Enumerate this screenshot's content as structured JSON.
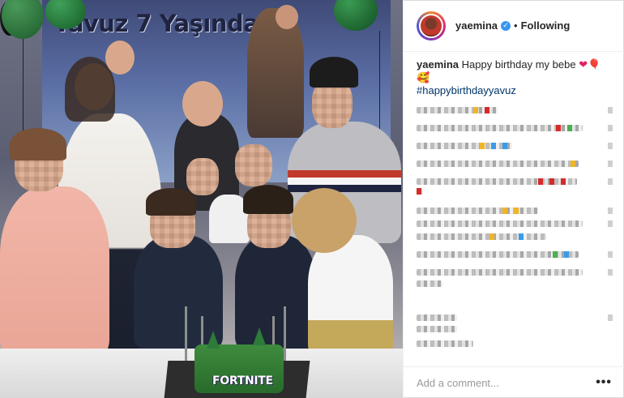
{
  "photo": {
    "banner_text": "Yavuz 7 Yaşında",
    "cake_text": "FORTNITE"
  },
  "header": {
    "username": "yaemina",
    "verified_icon": "verified-badge-icon",
    "separator": "•",
    "follow_status": "Following"
  },
  "caption": {
    "username": "yaemina",
    "text": "Happy birthday my bebe",
    "emoji": "❤🎈🥰",
    "hashtag": "#happybirthdayyavuz"
  },
  "comment_box": {
    "placeholder": "Add a comment...",
    "more_icon": "more-options-icon",
    "more_glyph": "•••"
  },
  "colors": {
    "accent": "#3897f0",
    "hashtag": "#003569",
    "border": "#efefef"
  }
}
